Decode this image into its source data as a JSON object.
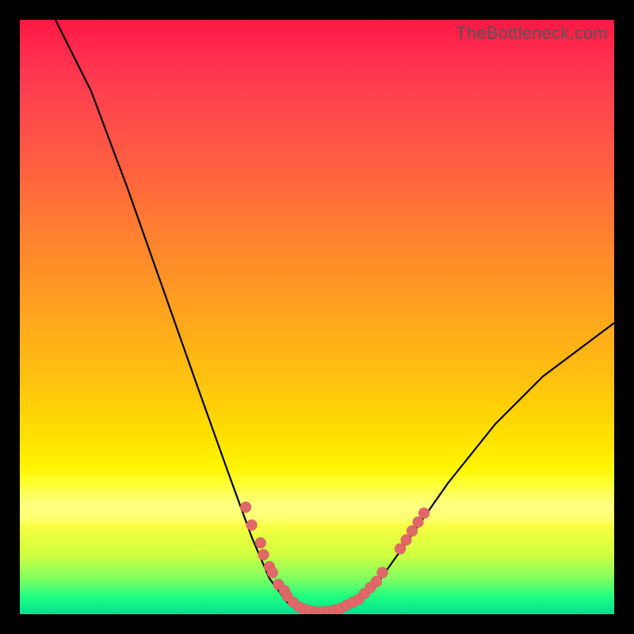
{
  "attribution": "TheBottleneck.com",
  "colors": {
    "point_fill": "#e06868",
    "curve_stroke": "#000000"
  },
  "chart_data": {
    "type": "line",
    "title": "",
    "xlabel": "",
    "ylabel": "",
    "xlim": [
      0,
      100
    ],
    "ylim": [
      0,
      100
    ],
    "grid": false,
    "legend": false,
    "curve": [
      {
        "x": 6,
        "y": 100
      },
      {
        "x": 12,
        "y": 88
      },
      {
        "x": 18,
        "y": 72
      },
      {
        "x": 24,
        "y": 55
      },
      {
        "x": 30,
        "y": 38
      },
      {
        "x": 35,
        "y": 24
      },
      {
        "x": 39,
        "y": 13
      },
      {
        "x": 42,
        "y": 6
      },
      {
        "x": 45,
        "y": 2
      },
      {
        "x": 48,
        "y": 0.5
      },
      {
        "x": 51,
        "y": 0.3
      },
      {
        "x": 54,
        "y": 0.5
      },
      {
        "x": 57,
        "y": 2
      },
      {
        "x": 60,
        "y": 5
      },
      {
        "x": 65,
        "y": 12
      },
      {
        "x": 72,
        "y": 22
      },
      {
        "x": 80,
        "y": 32
      },
      {
        "x": 88,
        "y": 40
      },
      {
        "x": 96,
        "y": 46
      },
      {
        "x": 100,
        "y": 49
      }
    ],
    "points": [
      {
        "x": 38,
        "y": 18
      },
      {
        "x": 39,
        "y": 15
      },
      {
        "x": 40.5,
        "y": 12
      },
      {
        "x": 41,
        "y": 10
      },
      {
        "x": 42,
        "y": 8
      },
      {
        "x": 42.5,
        "y": 7
      },
      {
        "x": 43.5,
        "y": 5
      },
      {
        "x": 44.5,
        "y": 4
      },
      {
        "x": 45,
        "y": 3
      },
      {
        "x": 46,
        "y": 2
      },
      {
        "x": 47,
        "y": 1.2
      },
      {
        "x": 48,
        "y": 0.8
      },
      {
        "x": 49,
        "y": 0.5
      },
      {
        "x": 50,
        "y": 0.4
      },
      {
        "x": 51,
        "y": 0.4
      },
      {
        "x": 52,
        "y": 0.5
      },
      {
        "x": 53,
        "y": 0.7
      },
      {
        "x": 54,
        "y": 1
      },
      {
        "x": 55,
        "y": 1.5
      },
      {
        "x": 56,
        "y": 2
      },
      {
        "x": 57,
        "y": 2.5
      },
      {
        "x": 58,
        "y": 3.5
      },
      {
        "x": 59,
        "y": 4.5
      },
      {
        "x": 60,
        "y": 5.5
      },
      {
        "x": 61,
        "y": 7
      },
      {
        "x": 64,
        "y": 11
      },
      {
        "x": 65,
        "y": 12.5
      },
      {
        "x": 66,
        "y": 14
      },
      {
        "x": 67,
        "y": 15.5
      },
      {
        "x": 68,
        "y": 17
      }
    ]
  }
}
